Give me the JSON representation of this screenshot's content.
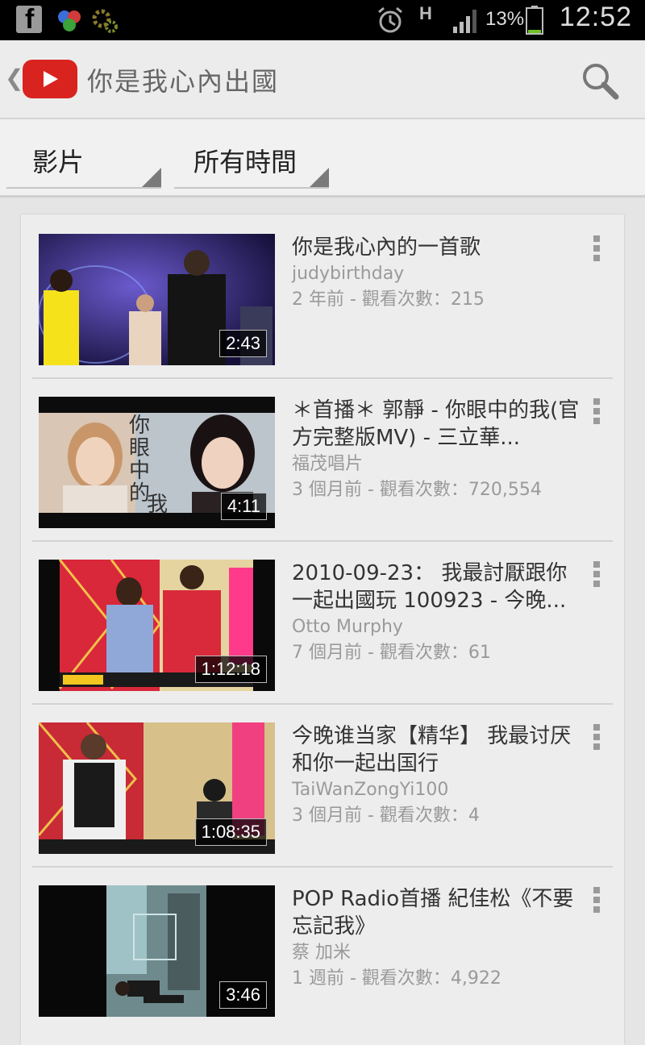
{
  "status_bar": {
    "battery": "13%",
    "time": "12:52",
    "network": "H"
  },
  "action_bar": {
    "title": "你是我心內出國"
  },
  "filters": {
    "type": "影片",
    "time": "所有時間"
  },
  "videos": [
    {
      "title": "你是我心內的一首歌",
      "channel": "judybirthday",
      "meta": "2 年前 - 觀看次數：215",
      "duration": "2:43"
    },
    {
      "title": "＊首播＊ 郭靜 - 你眼中的我(官方完整版MV) - 三立華...",
      "channel": "福茂唱片",
      "meta": "3 個月前 - 觀看次數：720,554",
      "duration": "4:11",
      "thumb_text": "你眼中的我"
    },
    {
      "title": "2010-09-23： 我最討厭跟你一起出國玩 100923 - 今晚...",
      "channel": "Otto Murphy",
      "meta": "7 個月前 - 觀看次數：61",
      "duration": "1:12:18"
    },
    {
      "title": "今晚谁当家【精华】 我最讨厌和你一起出国行",
      "channel": "TaiWanZongYi100",
      "meta": "3 個月前 - 觀看次數：4",
      "duration": "1:08:35"
    },
    {
      "title": "POP Radio首播 紀佳松《不要忘記我》",
      "channel": "蔡 加米",
      "meta": "1 週前 - 觀看次數：4,922",
      "duration": "3:46"
    }
  ],
  "colors": {
    "youtube_red": "#d9231f",
    "background": "#e5e5e5"
  }
}
